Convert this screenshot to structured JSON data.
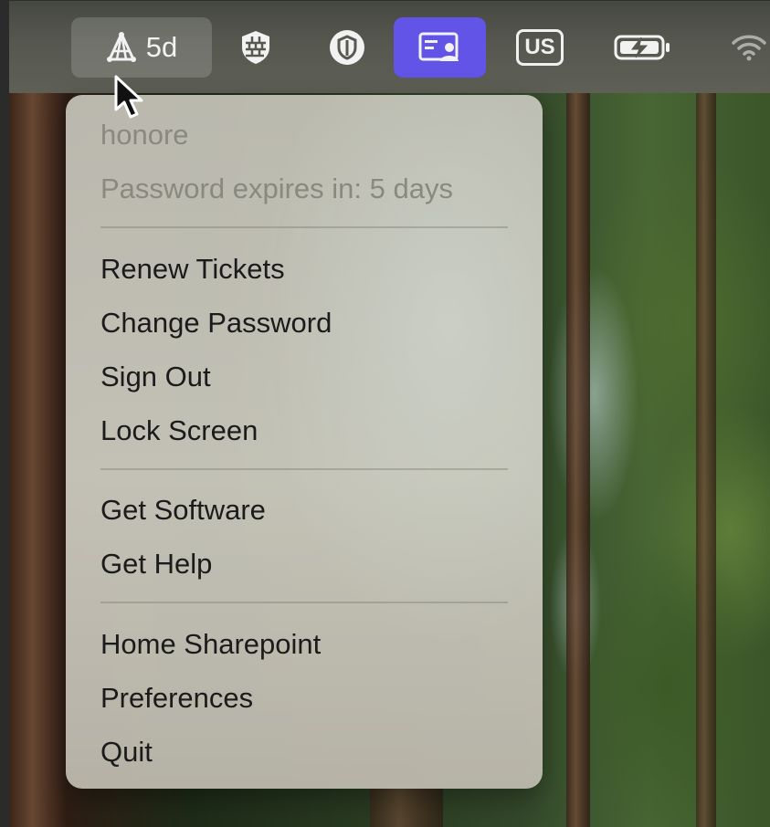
{
  "menubar": {
    "kerberos_status": "5d",
    "keyboard_layout": "US",
    "icons": [
      "kerberos-app-icon",
      "firewall-shield-icon",
      "vpn-shield-icon",
      "screen-sharing-icon",
      "keyboard-layout-icon",
      "battery-charging-icon",
      "wifi-icon"
    ],
    "active_color": "#6254e6"
  },
  "menu": {
    "username": "honore",
    "password_status": "Password expires in: 5 days",
    "groups": [
      [
        "Renew Tickets",
        "Change Password",
        "Sign Out",
        "Lock Screen"
      ],
      [
        "Get Software",
        "Get Help"
      ],
      [
        "Home Sharepoint",
        "Preferences",
        "Quit"
      ]
    ]
  }
}
